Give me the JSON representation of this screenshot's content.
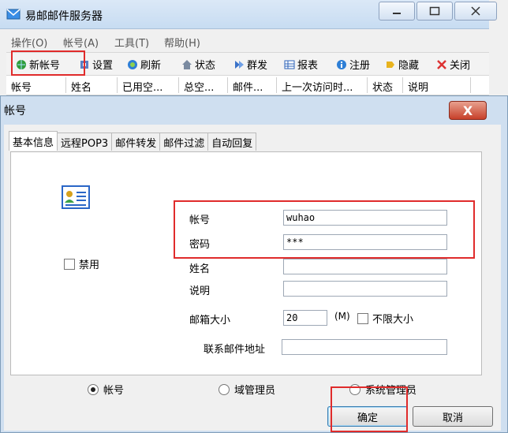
{
  "main_window": {
    "title": "易邮邮件服务器",
    "menu": [
      "操作(O)",
      "帐号(A)",
      "工具(T)",
      "帮助(H)"
    ],
    "toolbar": [
      {
        "label": "新帐号",
        "icon": "globe-icon"
      },
      {
        "label": "设置",
        "icon": "settings-icon"
      },
      {
        "label": "刷新",
        "icon": "refresh-icon"
      },
      {
        "label": "状态",
        "icon": "status-icon"
      },
      {
        "label": "群发",
        "icon": "broadcast-icon"
      },
      {
        "label": "报表",
        "icon": "report-icon"
      },
      {
        "label": "注册",
        "icon": "info-icon"
      },
      {
        "label": "隐藏",
        "icon": "hide-icon"
      },
      {
        "label": "关闭",
        "icon": "close-x-icon"
      }
    ],
    "columns": [
      "帐号",
      "姓名",
      "已用空...",
      "总空...",
      "邮件...",
      "上一次访问时...",
      "状态",
      "说明"
    ]
  },
  "dialog": {
    "title": "帐号",
    "close_label": "X",
    "tabs": [
      "基本信息",
      "远程POP3",
      "邮件转发",
      "邮件过滤",
      "自动回复"
    ],
    "disable_label": "禁用",
    "fields": {
      "account": {
        "label": "帐号",
        "value": "wuhao"
      },
      "password": {
        "label": "密码",
        "value": "***"
      },
      "name": {
        "label": "姓名",
        "value": ""
      },
      "description": {
        "label": "说明",
        "value": ""
      },
      "mailbox_size": {
        "label": "邮箱大小",
        "value": "20",
        "unit": "(M)"
      },
      "unlimited_label": "不限大小",
      "contact_email": {
        "label": "联系邮件地址",
        "value": ""
      }
    },
    "roles": [
      {
        "label": "帐号",
        "selected": true
      },
      {
        "label": "域管理员",
        "selected": false
      },
      {
        "label": "系统管理员",
        "selected": false
      }
    ],
    "ok_label": "确定",
    "cancel_label": "取消"
  },
  "colors": {
    "highlight": "#e02b2b",
    "dialog_frame": "#cfdff0",
    "close_button": "#c7402a"
  }
}
